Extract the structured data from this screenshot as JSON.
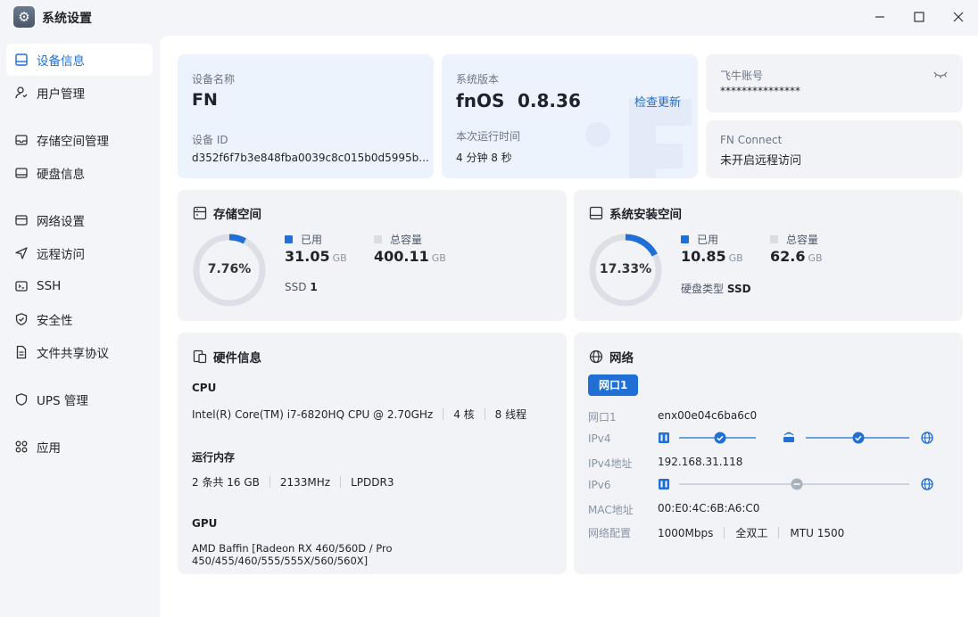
{
  "window": {
    "title": "系统设置",
    "icon": "gear-icon"
  },
  "sidebar": {
    "items": [
      {
        "label": "设备信息",
        "icon": "device-icon",
        "active": true
      },
      {
        "label": "用户管理",
        "icon": "user-icon"
      },
      {
        "label": "存储空间管理",
        "icon": "storage-icon"
      },
      {
        "label": "硬盘信息",
        "icon": "disk-icon"
      },
      {
        "label": "网络设置",
        "icon": "network-icon"
      },
      {
        "label": "远程访问",
        "icon": "remote-icon"
      },
      {
        "label": "SSH",
        "icon": "terminal-icon"
      },
      {
        "label": "安全性",
        "icon": "shield-icon"
      },
      {
        "label": "文件共享协议",
        "icon": "file-share-icon"
      },
      {
        "label": "UPS 管理",
        "icon": "ups-icon"
      },
      {
        "label": "应用",
        "icon": "apps-icon"
      }
    ]
  },
  "device": {
    "name_label": "设备名称",
    "name": "FN",
    "id_label": "设备 ID",
    "id": "d352f6f7b3e848fba0039c8c015b0d5995b..."
  },
  "system": {
    "version_label": "系统版本",
    "os": "fnOS",
    "version": "0.8.36",
    "check_update": "检查更新",
    "uptime_label": "本次运行时间",
    "uptime": "4 分钟 8 秒"
  },
  "account": {
    "label": "飞牛账号",
    "value": "***************",
    "icon": "eye-closed-icon"
  },
  "connect": {
    "label": "FN Connect",
    "value": "未开启远程访问"
  },
  "storage": {
    "title": "存储空间",
    "percent": 7.76,
    "percent_text": "7.76%",
    "used_label": "已用",
    "used_value": "31.05",
    "used_unit": "GB",
    "total_label": "总容量",
    "total_value": "400.11",
    "total_unit": "GB",
    "disk_type": "SSD",
    "disk_count": "1",
    "used_color": "#1f6fd6",
    "total_color": "#d9dde3"
  },
  "system_space": {
    "title": "系统安装空间",
    "percent": 17.33,
    "percent_text": "17.33%",
    "used_label": "已用",
    "used_value": "10.85",
    "used_unit": "GB",
    "total_label": "总容量",
    "total_value": "62.6",
    "total_unit": "GB",
    "disk_type_label": "硬盘类型",
    "disk_type": "SSD"
  },
  "hardware": {
    "title": "硬件信息",
    "cpu_label": "CPU",
    "cpu_model": "Intel(R) Core(TM) i7-6820HQ CPU @ 2.70GHz",
    "cpu_cores": "4 核",
    "cpu_threads": "8 线程",
    "mem_label": "运行内存",
    "mem_size": "2 条共 16 GB",
    "mem_freq": "2133MHz",
    "mem_type": "LPDDR3",
    "gpu_label": "GPU",
    "gpu_model": "AMD Baffin [Radeon RX 460/560D / Pro 450/455/460/555/555X/560/560X]"
  },
  "network": {
    "title": "网络",
    "tab": "网口1",
    "port_label": "网口1",
    "port_value": "enx00e04c6ba6c0",
    "ipv4_label": "IPv4",
    "ipv4_addr_label": "IPv4地址",
    "ipv4_addr": "192.168.31.118",
    "ipv6_label": "IPv6",
    "mac_label": "MAC地址",
    "mac": "00:E0:4C:6B:A6:C0",
    "config_label": "网络配置",
    "speed": "1000Mbps",
    "duplex": "全双工",
    "mtu": "MTU 1500",
    "ok_color": "#1f6fd6",
    "off_color": "#a9b1bd"
  }
}
